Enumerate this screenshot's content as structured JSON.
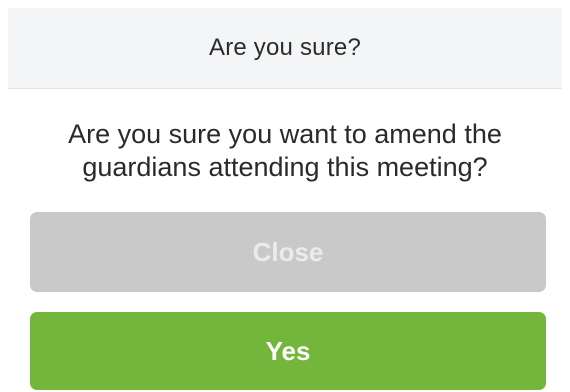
{
  "dialog": {
    "title": "Are you sure?",
    "message": "Are you sure you want to amend the guardians attending this meeting?",
    "buttons": {
      "close_label": "Close",
      "yes_label": "Yes"
    }
  },
  "colors": {
    "header_bg": "#f4f5f7",
    "close_button_bg": "#c9c9c9",
    "yes_button_bg": "#74b63b",
    "text": "#2a2a2a"
  }
}
